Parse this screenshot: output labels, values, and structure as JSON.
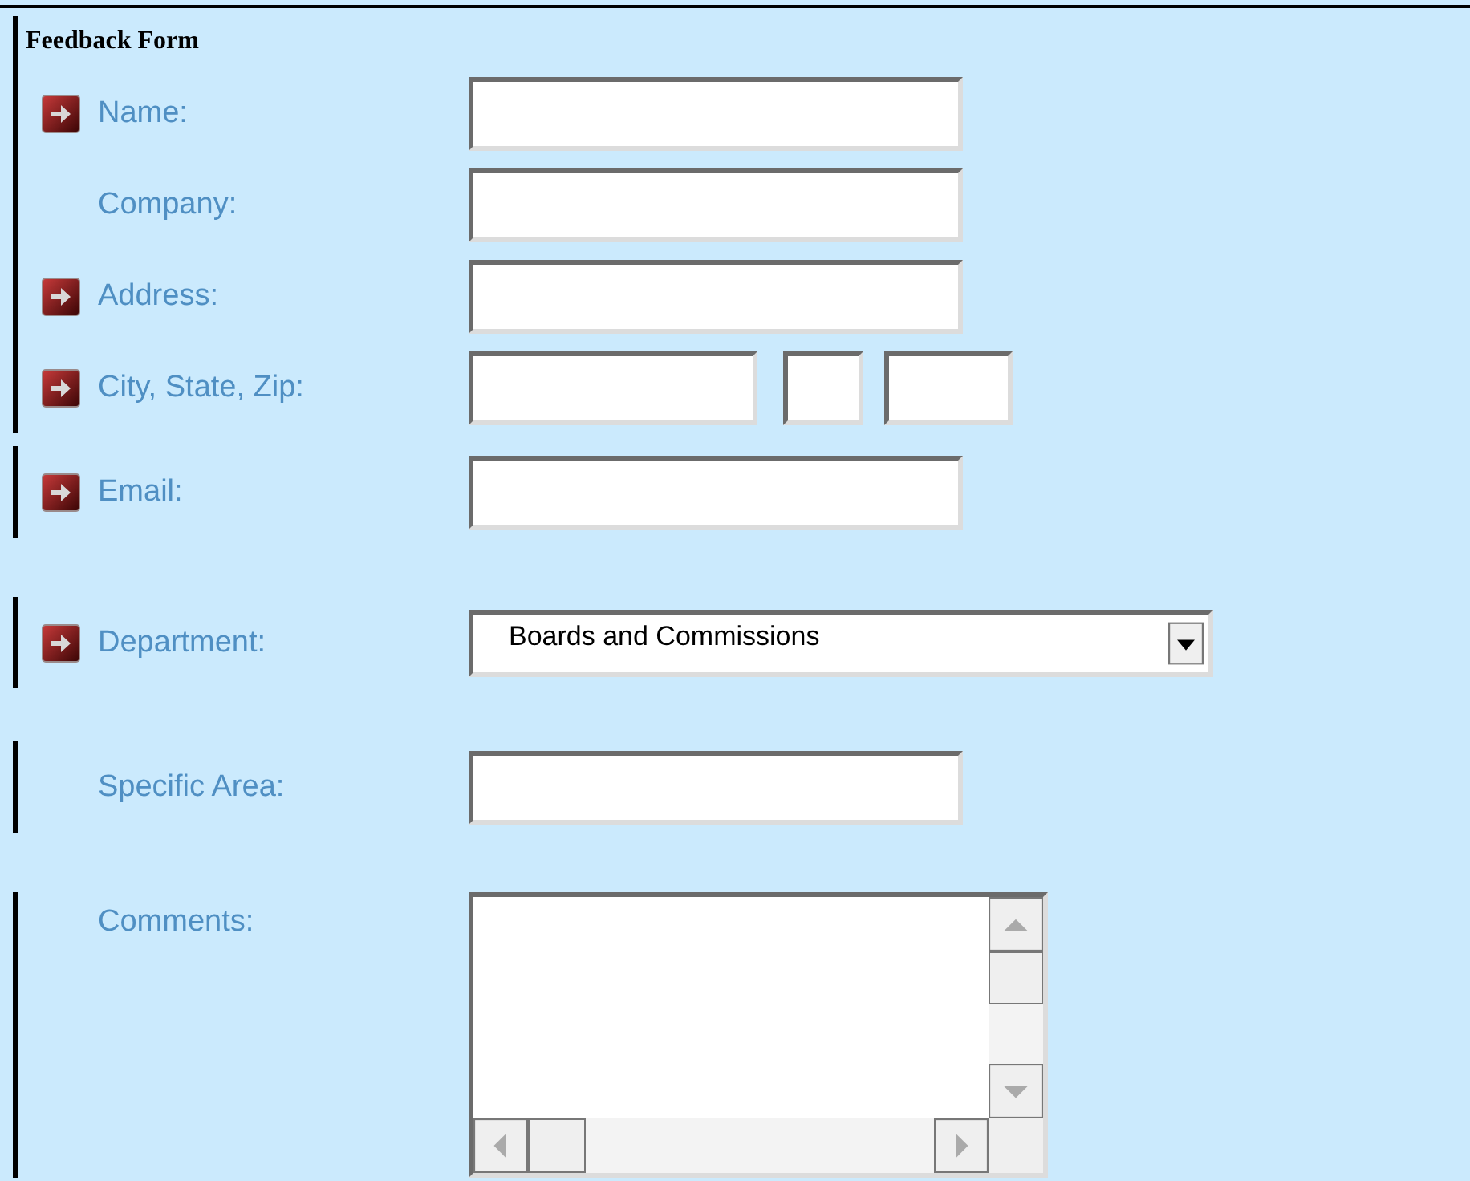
{
  "form": {
    "title": "Feedback Form",
    "rows": [
      {
        "label": "Name:",
        "required": true,
        "kind": "text"
      },
      {
        "label": "Company:",
        "required": false,
        "kind": "text"
      },
      {
        "label": "Address:",
        "required": true,
        "kind": "text"
      },
      {
        "label": "City, State, Zip:",
        "required": true,
        "kind": "city-state-zip"
      },
      {
        "label": "Email:",
        "required": true,
        "kind": "text"
      },
      {
        "label": "Department:",
        "required": true,
        "kind": "select",
        "value": "Boards and Commissions"
      },
      {
        "label": "Specific Area:",
        "required": false,
        "kind": "text"
      },
      {
        "label": "Comments:",
        "required": false,
        "kind": "textarea"
      }
    ]
  }
}
